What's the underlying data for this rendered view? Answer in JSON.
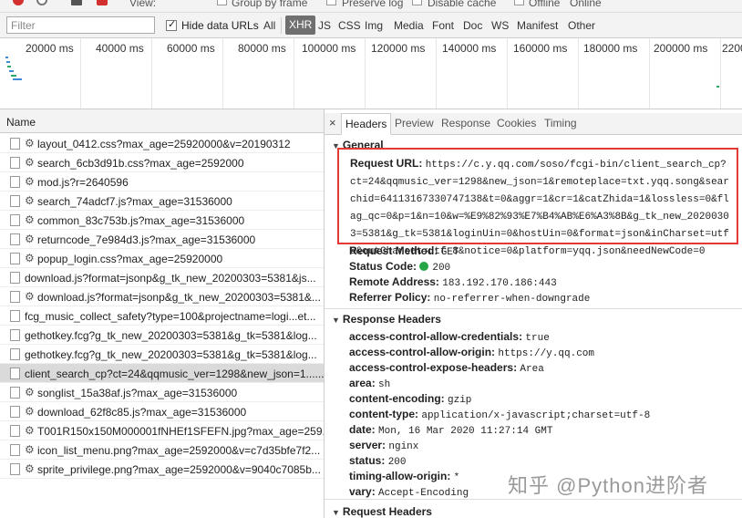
{
  "toolbar": {
    "view_label": "View:",
    "group_label": "Group by frame",
    "preserve_label": "Preserve log",
    "disable_cache_label": "Disable cache",
    "offline_label": "Offline",
    "online_label": "Online"
  },
  "filter": {
    "placeholder": "Filter",
    "hide_data_urls": "Hide data URLs",
    "types": [
      "All",
      "XHR",
      "JS",
      "CSS",
      "Img",
      "Media",
      "Font",
      "Doc",
      "WS",
      "Manifest",
      "Other"
    ],
    "active_type": "XHR"
  },
  "timeline": {
    "ticks": [
      "20000 ms",
      "40000 ms",
      "60000 ms",
      "80000 ms",
      "100000 ms",
      "120000 ms",
      "140000 ms",
      "160000 ms",
      "180000 ms",
      "200000 ms",
      "2200"
    ]
  },
  "list": {
    "header": "Name",
    "rows": [
      {
        "name": "layout_0412.css?max_age=25920000&v=20190312",
        "gear": true
      },
      {
        "name": "search_6cb3d91b.css?max_age=2592000",
        "gear": true
      },
      {
        "name": "mod.js?r=2640596",
        "gear": true
      },
      {
        "name": "search_74adcf7.js?max_age=31536000",
        "gear": true
      },
      {
        "name": "common_83c753b.js?max_age=31536000",
        "gear": true
      },
      {
        "name": "returncode_7e984d3.js?max_age=31536000",
        "gear": true
      },
      {
        "name": "popup_login.css?max_age=25920000",
        "gear": true
      },
      {
        "name": "download.js?format=jsonp&g_tk_new_20200303=5381&js...",
        "gear": false
      },
      {
        "name": "download.js?format=jsonp&g_tk_new_20200303=5381&...",
        "gear": true
      },
      {
        "name": "fcg_music_collect_safety?type=100&projectname=logi...et...",
        "gear": false
      },
      {
        "name": "gethotkey.fcg?g_tk_new_20200303=5381&g_tk=5381&log...",
        "gear": false
      },
      {
        "name": "gethotkey.fcg?g_tk_new_20200303=5381&g_tk=5381&log...",
        "gear": false
      },
      {
        "name": "client_search_cp?ct=24&qqmusic_ver=1298&new_json=1......",
        "gear": false,
        "selected": true
      },
      {
        "name": "songlist_15a38af.js?max_age=31536000",
        "gear": true
      },
      {
        "name": "download_62f8c85.js?max_age=31536000",
        "gear": true
      },
      {
        "name": "T001R150x150M000001fNHEf1SFEFN.jpg?max_age=259...",
        "gear": true
      },
      {
        "name": "icon_list_menu.png?max_age=2592000&v=c7d35bfe7f2...",
        "gear": true
      },
      {
        "name": "sprite_privilege.png?max_age=2592000&v=9040c7085b...",
        "gear": true
      }
    ]
  },
  "details": {
    "close": "×",
    "tabs": [
      "Headers",
      "Preview",
      "Response",
      "Cookies",
      "Timing"
    ],
    "active_tab": "Headers",
    "general": {
      "title": "General",
      "request_url_label": "Request URL:",
      "request_url": "https://c.y.qq.com/soso/fcgi-bin/client_search_cp?ct=24&qqmusic_ver=1298&new_json=1&remoteplace=txt.yqq.song&searchid=64113167330747138&t=0&aggr=1&cr=1&catZhida=1&lossless=0&flag_qc=0&p=1&n=10&w=%E9%82%93%E7%B4%AB%E6%A3%8B&g_tk_new_20200303=5381&g_tk=5381&loginUin=0&hostUin=0&format=json&inCharset=utf8&outCharset=utf-8&notice=0&platform=yqq.json&needNewCode=0",
      "method_label": "Request Method:",
      "method": "GET",
      "status_label": "Status Code:",
      "status": "200",
      "remote_label": "Remote Address:",
      "remote": "183.192.170.186:443",
      "referrer_label": "Referrer Policy:",
      "referrer": "no-referrer-when-downgrade"
    },
    "response_headers": {
      "title": "Response Headers",
      "items": [
        {
          "k": "access-control-allow-credentials:",
          "v": "true"
        },
        {
          "k": "access-control-allow-origin:",
          "v": "https://y.qq.com"
        },
        {
          "k": "access-control-expose-headers:",
          "v": "Area"
        },
        {
          "k": "area:",
          "v": "sh"
        },
        {
          "k": "content-encoding:",
          "v": "gzip"
        },
        {
          "k": "content-type:",
          "v": "application/x-javascript;charset=utf-8"
        },
        {
          "k": "date:",
          "v": "Mon, 16 Mar 2020 11:27:14 GMT"
        },
        {
          "k": "server:",
          "v": "nginx"
        },
        {
          "k": "status:",
          "v": "200"
        },
        {
          "k": "timing-allow-origin:",
          "v": "*"
        },
        {
          "k": "vary:",
          "v": "Accept-Encoding"
        }
      ]
    },
    "request_headers": {
      "title": "Request Headers"
    }
  },
  "watermark": "知乎 @Python进阶者",
  "colors": {
    "highlight_box": "#e53935",
    "status_ok": "#26a644",
    "active_chip": "#6f6f6f"
  }
}
